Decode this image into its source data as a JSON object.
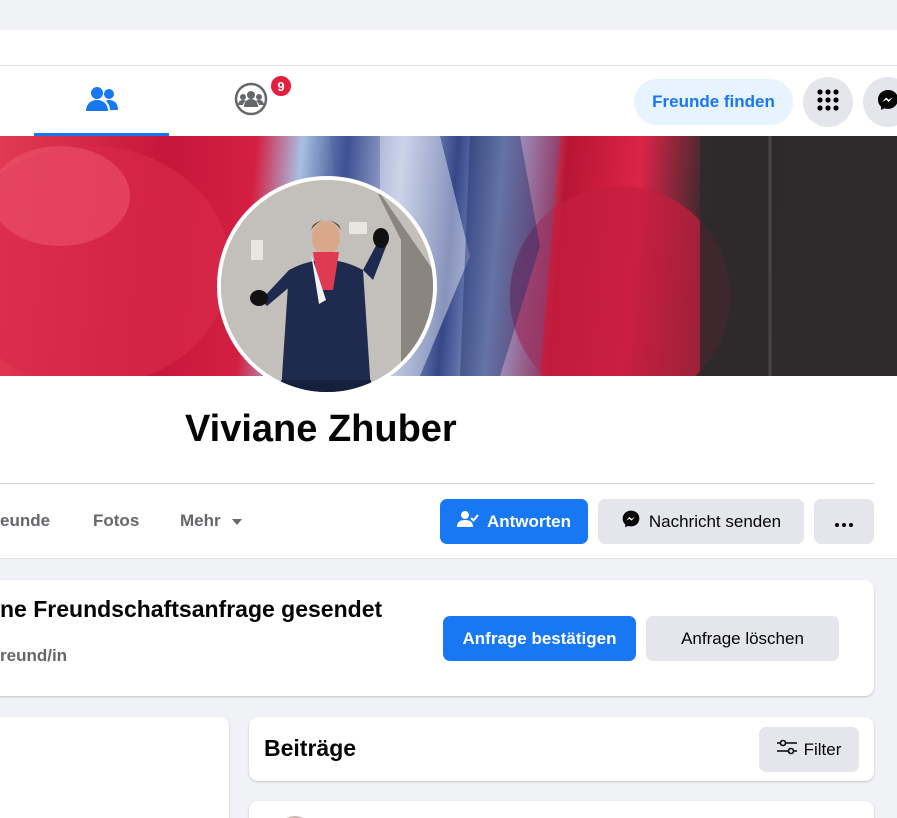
{
  "nav": {
    "badge_count": "9",
    "find_friends_label": "Freunde finden",
    "icons": [
      "friends-icon",
      "groups-icon",
      "menu-grid-icon",
      "messenger-icon"
    ]
  },
  "profile": {
    "name": "Viviane Zhuber"
  },
  "tabs": {
    "friends_label": "eunde",
    "photos_label": "Fotos",
    "more_label": "Mehr"
  },
  "actions": {
    "reply_label": "Antworten",
    "message_label": "Nachricht senden",
    "more_glyph": "···"
  },
  "request": {
    "title": "ne Freundschaftsanfrage gesendet",
    "subtitle": "reund/in",
    "confirm_label": "Anfrage bestätigen",
    "delete_label": "Anfrage löschen"
  },
  "posts": {
    "title": "Beiträge",
    "filter_label": "Filter"
  },
  "colors": {
    "accent": "#1877f2",
    "badge": "#e41e3f",
    "background": "#f0f2f5"
  }
}
